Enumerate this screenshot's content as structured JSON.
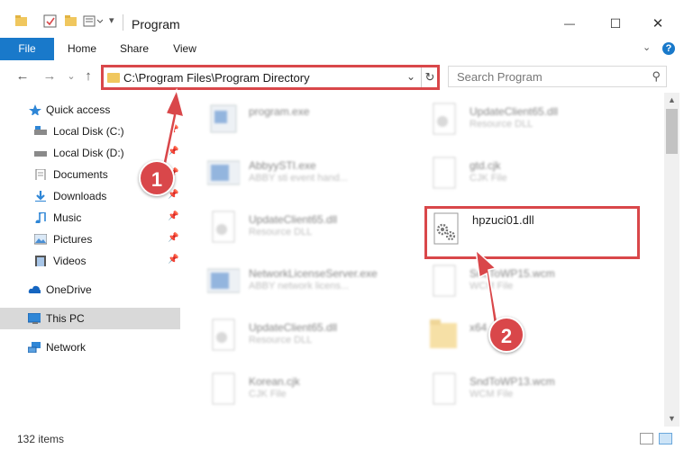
{
  "window": {
    "title": "Program",
    "minimize_glyph": "—",
    "maximize_glyph": "☐",
    "close_glyph": "✕"
  },
  "ribbon": {
    "tabs": [
      "File",
      "Home",
      "Share",
      "View"
    ],
    "help_glyph": "?",
    "collapse_glyph": "⌄"
  },
  "navigation": {
    "back_glyph": "←",
    "forward_glyph": "→",
    "recent_glyph": "⌄",
    "up_glyph": "↑"
  },
  "address_bar": {
    "path": "C:\\Program Files\\Program Directory",
    "dropdown_glyph": "⌄",
    "refresh_glyph": "↻"
  },
  "search": {
    "placeholder": "Search Program",
    "icon_glyph": "⚲"
  },
  "sidebar": {
    "items": [
      {
        "label": "Quick access",
        "icon": "star-icon"
      },
      {
        "label": "Local Disk (C:)",
        "icon": "drive-icon",
        "pinned": true
      },
      {
        "label": "Local Disk (D:)",
        "icon": "drive-icon",
        "pinned": true
      },
      {
        "label": "Documents",
        "icon": "documents-icon",
        "pinned": true
      },
      {
        "label": "Downloads",
        "icon": "downloads-icon",
        "pinned": true
      },
      {
        "label": "Music",
        "icon": "music-icon",
        "pinned": true
      },
      {
        "label": "Pictures",
        "icon": "pictures-icon",
        "pinned": true
      },
      {
        "label": "Videos",
        "icon": "videos-icon",
        "pinned": true
      },
      {
        "label": "OneDrive",
        "icon": "cloud-icon"
      },
      {
        "label": "This PC",
        "icon": "computer-icon",
        "selected": true
      },
      {
        "label": "Network",
        "icon": "network-icon"
      }
    ],
    "pin_glyph": "📌"
  },
  "files": [
    {
      "name": "program.exe",
      "type": ""
    },
    {
      "name": "UpdateClient65.dll",
      "type": "Resource DLL"
    },
    {
      "name": "AbbyySTI.exe",
      "type": "ABBY sti event hand..."
    },
    {
      "name": "gtd.cjk",
      "type": "CJK File"
    },
    {
      "name": "UpdateClient65.dll",
      "type": "Resource DLL"
    },
    {
      "name": "hpzuci01.dll",
      "type": ""
    },
    {
      "name": "NetworkLicenseServer.exe",
      "type": "ABBY network licens..."
    },
    {
      "name": "SndToWP15.wcm",
      "type": "WCM File"
    },
    {
      "name": "UpdateClient65.dll",
      "type": "Resource DLL"
    },
    {
      "name": "x64",
      "type": ""
    },
    {
      "name": "Korean.cjk",
      "type": "CJK File"
    },
    {
      "name": "SndToWP13.wcm",
      "type": "WCM File"
    }
  ],
  "status": {
    "item_count": "132 items"
  },
  "callouts": {
    "step1": "1",
    "step2": "2"
  },
  "colors": {
    "accent": "#1979ca",
    "callout": "#d9474a",
    "folder": "#f0c75e"
  }
}
